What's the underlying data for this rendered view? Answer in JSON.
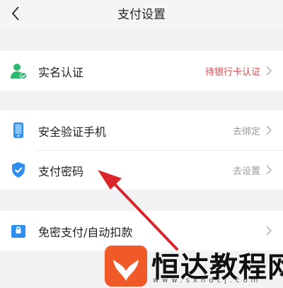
{
  "header": {
    "title": "支付设置",
    "back_icon": "chevron-left-icon"
  },
  "groups": [
    {
      "rows": [
        {
          "label": "实名认证",
          "value": "待银行卡认证",
          "value_color": "#e2464a",
          "icon": "user-verified-icon"
        }
      ]
    },
    {
      "rows": [
        {
          "label": "安全验证手机",
          "value": "去绑定",
          "icon": "phone-icon"
        },
        {
          "label": "支付密码",
          "value": "去设置",
          "icon": "shield-check-icon"
        }
      ]
    },
    {
      "rows": [
        {
          "label": "免密支付/自动扣款",
          "value": "",
          "icon": "lock-icon"
        }
      ]
    }
  ],
  "colors": {
    "accent_blue": "#2f8ff0",
    "accent_green": "#2eb872",
    "warning_red": "#e2464a",
    "arrow_red": "#d9262c"
  },
  "watermark": {
    "text": "恒达教程网",
    "url": "www.sxhdcj.com"
  }
}
